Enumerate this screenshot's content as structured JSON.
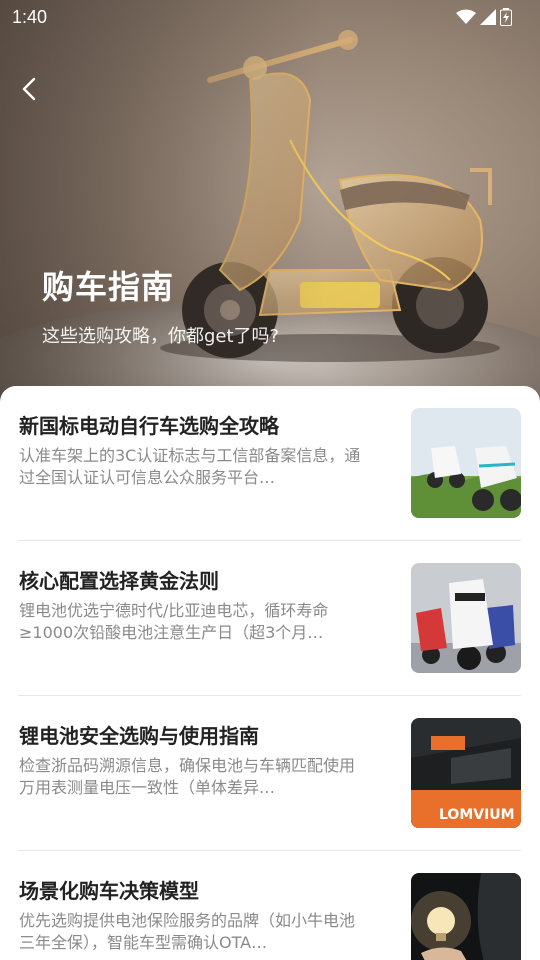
{
  "status_bar": {
    "time": "1:40"
  },
  "hero": {
    "title": "购车指南",
    "subtitle": "这些选购攻略，你都get了吗?"
  },
  "articles": [
    {
      "title": "新国标电动自行车选购全攻略",
      "desc": "认准车架上的3C认证标志与工信部备案信息，通过全国认证认可信息公众服务平台…",
      "thumb_icon": "scooters-on-grass-image"
    },
    {
      "title": "核心配置选择黄金法则",
      "desc": "锂电池优选宁德时代/比亚迪电芯，循环寿命≥1000次铅酸电池注意生产日（超3个月…",
      "thumb_icon": "scooters-lineup-image"
    },
    {
      "title": "锂电池安全选购与使用指南",
      "desc": "检查浙品码溯源信息，确保电池与车辆匹配使用万用表测量电压一致性（单体差异…",
      "thumb_icon": "battery-pack-image",
      "thumb_text": "LOMVIUM"
    },
    {
      "title": "场景化购车决策模型",
      "desc": "优先选购提供电池保险服务的品牌（如小牛电池三年全保），智能车型需确认OTA…",
      "thumb_icon": "lightbulb-hand-image"
    }
  ],
  "colors": {
    "title_text": "#222222",
    "desc_text": "#8a8a8a",
    "divider": "#e6e6e6",
    "scooter_glow": "#e8b868"
  }
}
